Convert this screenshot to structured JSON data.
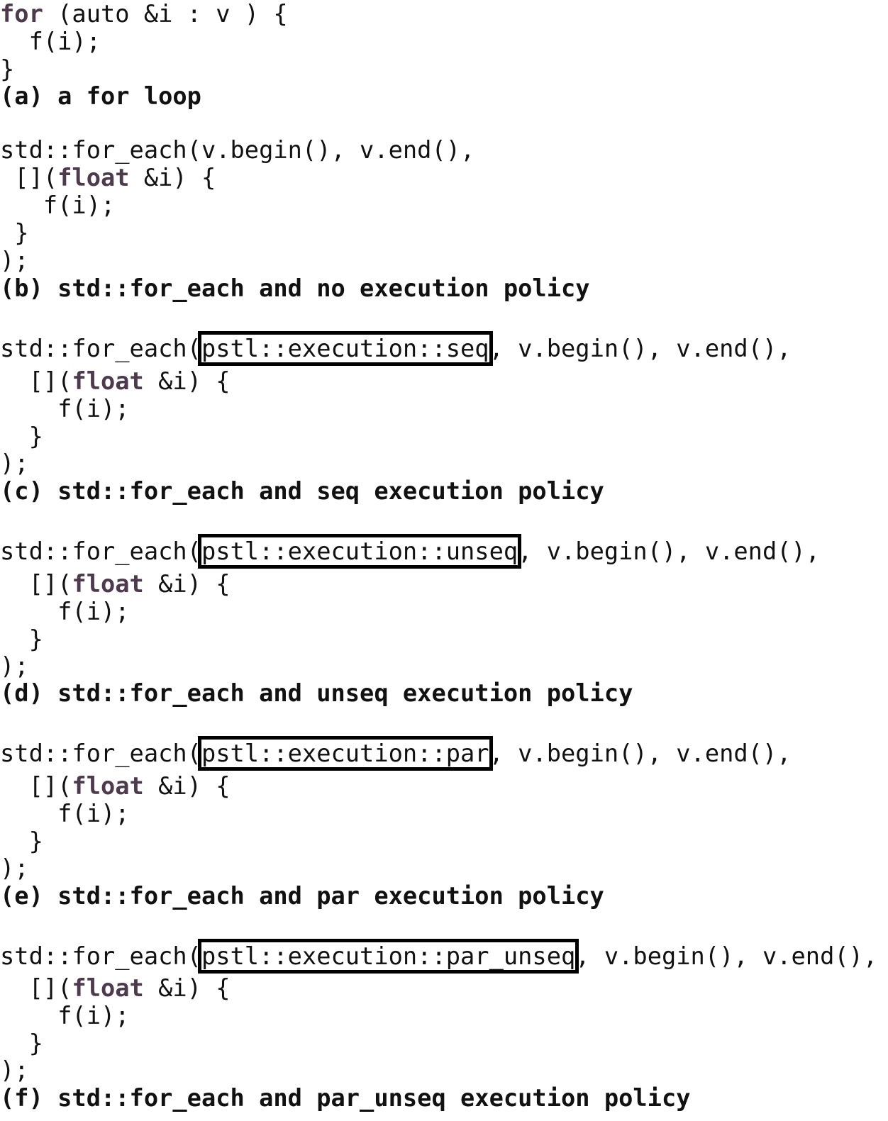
{
  "snippets": [
    {
      "id": "a",
      "lines": [
        {
          "kw": "for",
          "rest": " (auto &i : v ) {"
        },
        {
          "text": "  f(i);"
        },
        {
          "text": "}"
        }
      ],
      "caption": "(a) a for loop"
    },
    {
      "id": "b",
      "call_prefix": "std::for_each(v.begin(), v.end(),",
      "lambda_pre": " [](",
      "lambda_kw": "float",
      "lambda_post": " &i) {",
      "body": "   f(i);",
      "close_brace": " }",
      "close_call": ");",
      "caption": "(b) std::for_each and no execution policy"
    },
    {
      "id": "c",
      "call_prefix": "std::for_each(",
      "policy": "pstl::execution::seq",
      "call_suffix": ", v.begin(), v.end(),",
      "lambda_pre": "  [](",
      "lambda_kw": "float",
      "lambda_post": " &i) {",
      "body": "    f(i);",
      "close_brace": "  }",
      "close_call": ");",
      "caption": "(c) std::for_each and seq execution policy"
    },
    {
      "id": "d",
      "call_prefix": "std::for_each(",
      "policy": "pstl::execution::unseq",
      "call_suffix": ", v.begin(), v.end(),",
      "lambda_pre": "  [](",
      "lambda_kw": "float",
      "lambda_post": " &i) {",
      "body": "    f(i);",
      "close_brace": "  }",
      "close_call": ");",
      "caption": "(d) std::for_each and unseq execution policy"
    },
    {
      "id": "e",
      "call_prefix": "std::for_each(",
      "policy": "pstl::execution::par",
      "call_suffix": ", v.begin(), v.end(),",
      "lambda_pre": "  [](",
      "lambda_kw": "float",
      "lambda_post": " &i) {",
      "body": "    f(i);",
      "close_brace": "  }",
      "close_call": ");",
      "caption": "(e) std::for_each and par execution policy"
    },
    {
      "id": "f",
      "call_prefix": "std::for_each(",
      "policy": "pstl::execution::par_unseq",
      "call_suffix": ", v.begin(), v.end(),",
      "lambda_pre": "  [](",
      "lambda_kw": "float",
      "lambda_post": " &i) {",
      "body": "    f(i);",
      "close_brace": "  }",
      "close_call": ");",
      "caption": "(f) std::for_each and par_unseq execution policy"
    }
  ],
  "colors": {
    "text": "#111111",
    "keyword": "#4e3a4d",
    "box": "#000000",
    "background": "#ffffff"
  }
}
